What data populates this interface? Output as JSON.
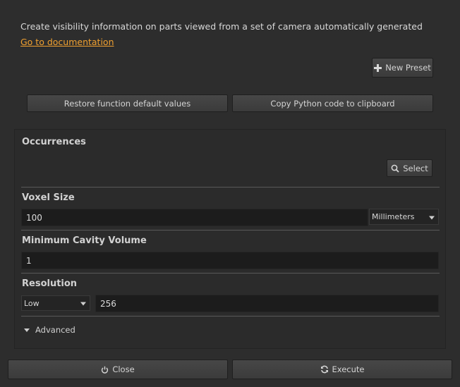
{
  "header": {
    "description": "Create visibility information on parts viewed from a set of camera automatically generated",
    "doc_link": "Go to documentation"
  },
  "toolbar": {
    "new_preset_label": "New Preset",
    "restore_label": "Restore function default values",
    "copy_python_label": "Copy Python code to clipboard"
  },
  "occurrences": {
    "title": "Occurrences",
    "select_label": "Select"
  },
  "voxel_size": {
    "title": "Voxel Size",
    "value": "100",
    "unit": "Millimeters"
  },
  "min_cavity": {
    "title": "Minimum Cavity Volume",
    "value": "1"
  },
  "resolution": {
    "title": "Resolution",
    "level": "Low",
    "value": "256"
  },
  "advanced_label": "Advanced",
  "footer": {
    "close_label": "Close",
    "execute_label": "Execute"
  },
  "colors": {
    "background": "#2d2d2d",
    "link": "#f0a030",
    "field": "#1c1c1c"
  }
}
